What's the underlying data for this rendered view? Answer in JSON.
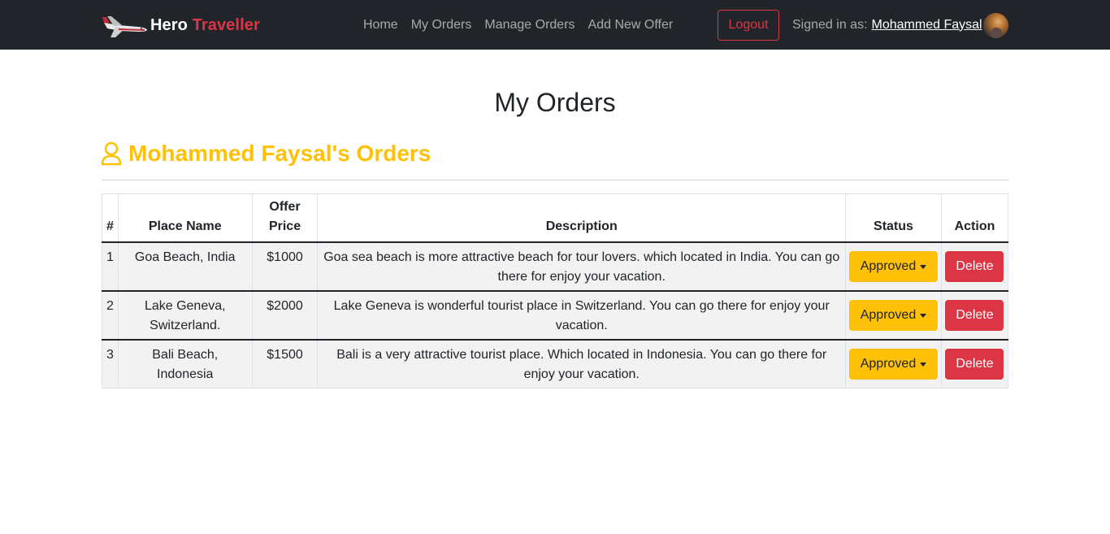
{
  "brand": {
    "part1": "Hero",
    "part2": "Traveller",
    "accent": "#dc3545"
  },
  "nav": {
    "links": [
      {
        "label": "Home"
      },
      {
        "label": "My Orders"
      },
      {
        "label": "Manage Orders"
      },
      {
        "label": "Add New Offer"
      }
    ],
    "logout_label": "Logout",
    "signed_in_prefix": "Signed in as:",
    "user_name": "Mohammed Faysal"
  },
  "page": {
    "title": "My Orders",
    "orders_heading": "Mohammed Faysal's Orders",
    "heading_color": "#ffc107"
  },
  "table": {
    "headers": [
      "#",
      "Place Name",
      "Offer Price",
      "Description",
      "Status",
      "Action"
    ],
    "rows": [
      {
        "index": "1",
        "place": "Goa Beach, India",
        "price": "$1000",
        "description": "Goa sea beach is more attractive beach for tour lovers. which located in India. You can go there for enjoy your vacation.",
        "status": "Approved",
        "action": "Delete"
      },
      {
        "index": "2",
        "place": "Lake Geneva, Switzerland.",
        "price": "$2000",
        "description": "Lake Geneva is wonderful tourist place in Switzerland. You can go there for enjoy your vacation.",
        "status": "Approved",
        "action": "Delete"
      },
      {
        "index": "3",
        "place": "Bali Beach, Indonesia",
        "price": "$1500",
        "description": "Bali is a very attractive tourist place. Which located in Indonesia. You can go there for enjoy your vacation.",
        "status": "Approved",
        "action": "Delete"
      }
    ]
  }
}
